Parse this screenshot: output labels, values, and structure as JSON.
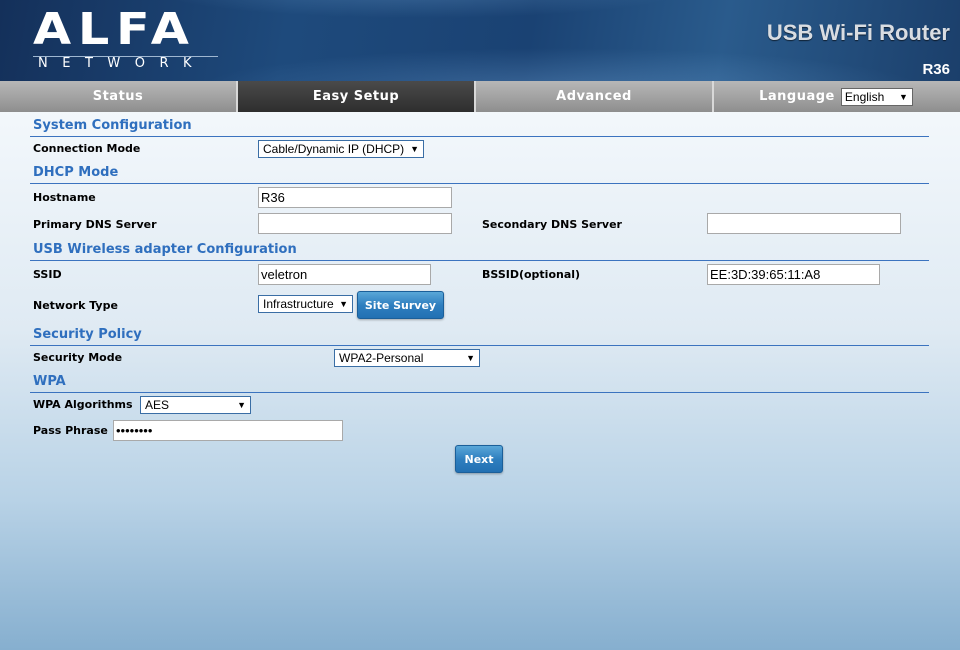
{
  "header": {
    "brand": "ALFA",
    "brand_sub": "NETWORK",
    "product_title": "USB Wi-Fi Router",
    "model": "R36"
  },
  "nav": {
    "items": [
      {
        "label": "Status"
      },
      {
        "label": "Easy Setup"
      },
      {
        "label": "Advanced"
      }
    ],
    "language_label": "Language",
    "language_value": "English"
  },
  "sections": {
    "system_config": "System Configuration",
    "dhcp_mode": "DHCP Mode",
    "usb_wireless": "USB Wireless adapter Configuration",
    "security_policy": "Security Policy",
    "wpa": "WPA"
  },
  "fields": {
    "connection_mode": {
      "label": "Connection Mode",
      "value": "Cable/Dynamic IP (DHCP)"
    },
    "hostname": {
      "label": "Hostname",
      "value": "R36"
    },
    "primary_dns": {
      "label": "Primary DNS Server",
      "value": ""
    },
    "secondary_dns": {
      "label": "Secondary DNS Server",
      "value": ""
    },
    "ssid": {
      "label": "SSID",
      "value": "veletron"
    },
    "bssid": {
      "label": "BSSID(optional)",
      "value": "EE:3D:39:65:11:A8"
    },
    "network_type": {
      "label": "Network Type",
      "value": "Infrastructure"
    },
    "security_mode": {
      "label": "Security Mode",
      "value": "WPA2-Personal"
    },
    "wpa_algorithms": {
      "label": "WPA Algorithms",
      "value": "AES"
    },
    "pass_phrase": {
      "label": "Pass Phrase",
      "value": "••••••••"
    }
  },
  "buttons": {
    "site_survey": "Site Survey",
    "next": "Next"
  },
  "colors": {
    "section_title": "#2f6fbe",
    "button": "#2f7fbf",
    "header_bg": "#1e4a7c"
  }
}
